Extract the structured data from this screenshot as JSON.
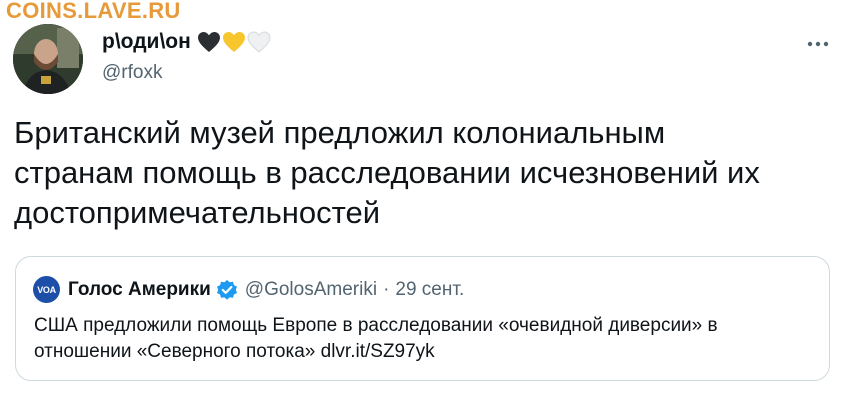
{
  "watermark": "COINS.LAVE.RU",
  "author": {
    "display_name": "р\\оди\\он",
    "handle": "@rfoxk",
    "hearts": [
      "black-heart-icon",
      "yellow-heart-icon",
      "white-heart-icon"
    ]
  },
  "tweet": {
    "text_lines": [
      "Британский музей предложил колониальным",
      "странам помощь в расследовании исчезновений их",
      "достопримечательностей"
    ]
  },
  "quote": {
    "logo_text": "VOA",
    "name": "Голос Америки",
    "handle": "@GolosAmeriki",
    "separator": "·",
    "date": "29 сент.",
    "text_lines": [
      "США предложили помощь Европе в расследовании «очевидной диверсии» в",
      "отношении «Северного потока» dlvr.it/SZ97yk"
    ]
  },
  "colors": {
    "watermark": "#e79a3a",
    "secondary_text": "#536471",
    "border": "#cfd9de",
    "verified": "#1d9bf0",
    "voa_blue": "#1d4fa8"
  }
}
